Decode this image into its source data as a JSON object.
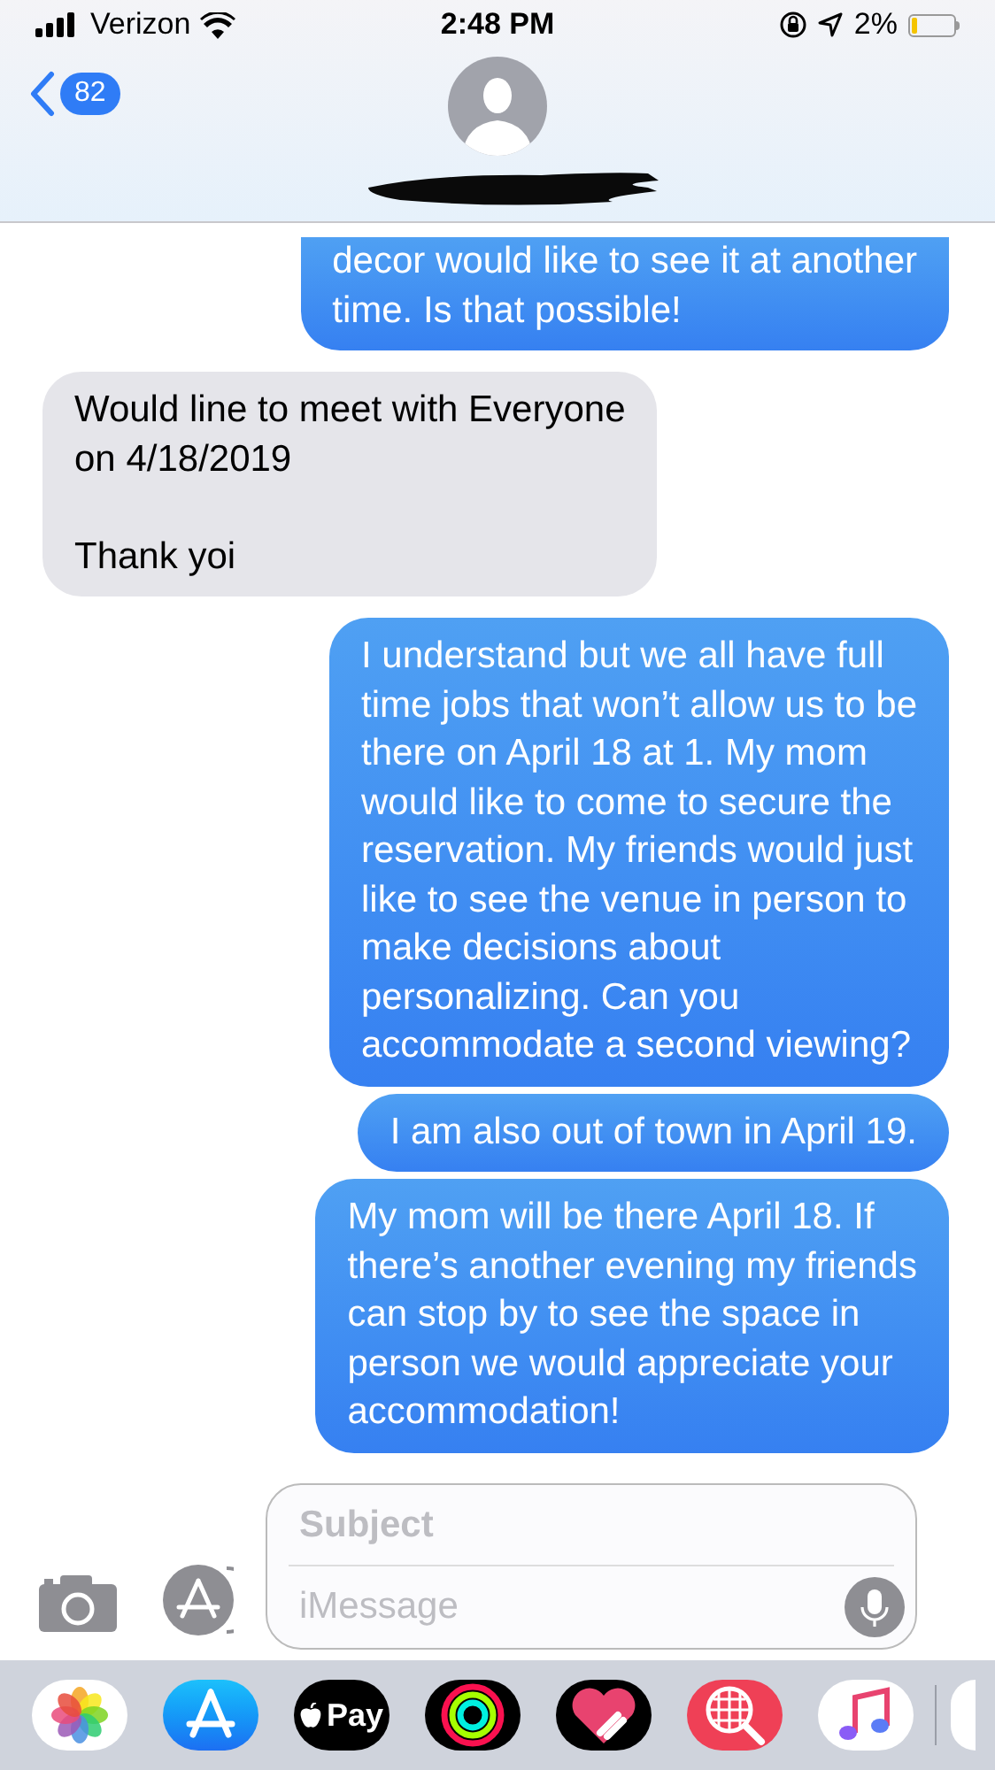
{
  "status_bar": {
    "carrier": "Verizon",
    "time": "2:48 PM",
    "battery": "2%"
  },
  "header": {
    "back_count": "82"
  },
  "messages": [
    {
      "kind": "outgoing",
      "cut_top": true,
      "text": "decor would like to see it at another\ntime. Is that possible!"
    },
    {
      "kind": "incoming",
      "cut_top": false,
      "text": "Would line to meet with Everyone\non 4/18/2019\n\nThank yoi"
    },
    {
      "kind": "outgoing",
      "cut_top": false,
      "text": "I understand but we all have full\ntime jobs that won’t allow us to be\nthere on April 18 at 1. My mom\nwould like to come to secure the\nreservation. My friends would just\nlike to see the venue in person to\nmake decisions about\npersonalizing. Can you\naccommodate a second viewing?"
    },
    {
      "kind": "outgoing",
      "cut_top": false,
      "text": "I am also out of town in April 19."
    },
    {
      "kind": "outgoing",
      "cut_top": false,
      "text": "My mom will be there April 18. If\nthere’s another evening my friends\ncan stop by to see the space in\nperson we would appreciate your\naccommodation!"
    }
  ],
  "compose": {
    "subject_placeholder": "Subject",
    "message_placeholder": "iMessage"
  },
  "dock": [
    {
      "kind": "photos"
    },
    {
      "kind": "appstore"
    },
    {
      "kind": "pay",
      "label": "Pay"
    },
    {
      "kind": "activity"
    },
    {
      "kind": "heart"
    },
    {
      "kind": "globe"
    },
    {
      "kind": "music"
    }
  ]
}
